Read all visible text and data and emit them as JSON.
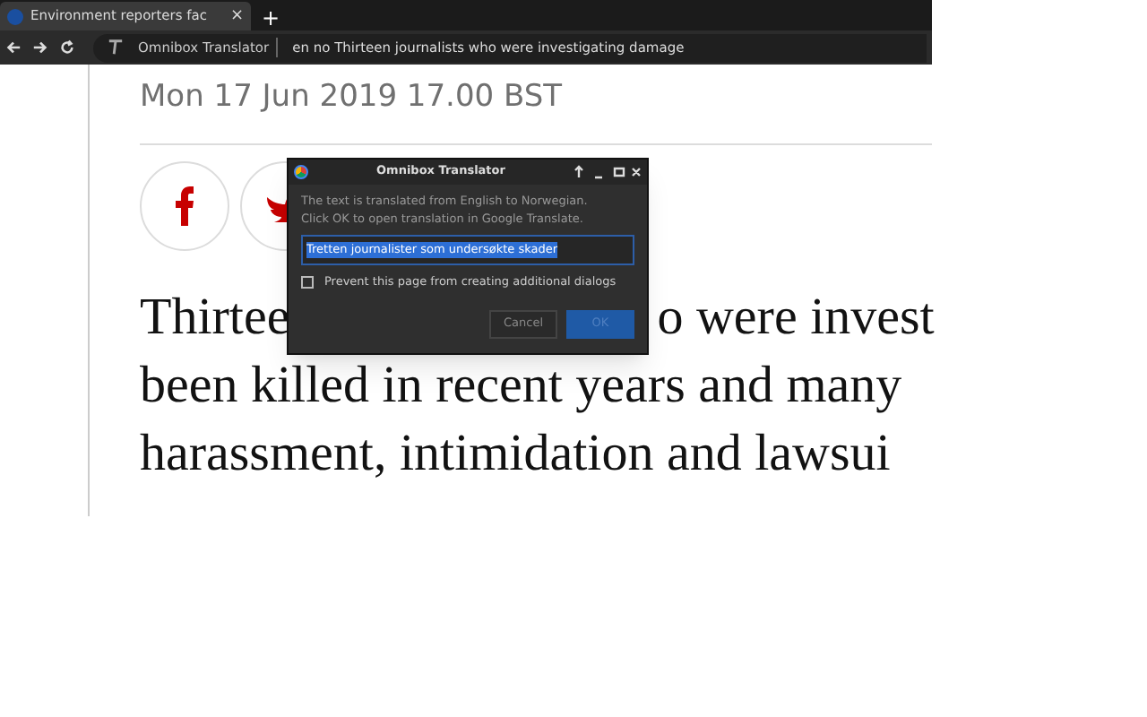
{
  "browser": {
    "tab": {
      "title": "Environment reporters fac",
      "close": "×"
    },
    "new_tab": "+",
    "omnibox": {
      "keyword": "Omnibox Translator",
      "text": "en no Thirteen journalists who were investigating damage"
    }
  },
  "article": {
    "dateline": "Mon 17 Jun 2019 17.00 BST",
    "lines": [
      {
        "parts": [
          "Thirtee",
          "o were invest"
        ]
      },
      {
        "parts": [
          "been killed in recent years and many"
        ]
      },
      {
        "parts": [
          "harassment, intimidation and lawsui"
        ]
      }
    ]
  },
  "dialog": {
    "title": "Omnibox Translator",
    "message": [
      "The text is translated from English to Norwegian.",
      "Click OK to open translation in Google Translate."
    ],
    "input": {
      "value": "Tretten journalister som undersøkte skader",
      "text_selected": true
    },
    "checkbox": {
      "label": "Prevent this page from creating additional dialogs",
      "checked": false
    },
    "buttons": [
      {
        "label": "Cancel",
        "kind": "secondary"
      },
      {
        "label": "OK",
        "kind": "primary"
      }
    ]
  }
}
